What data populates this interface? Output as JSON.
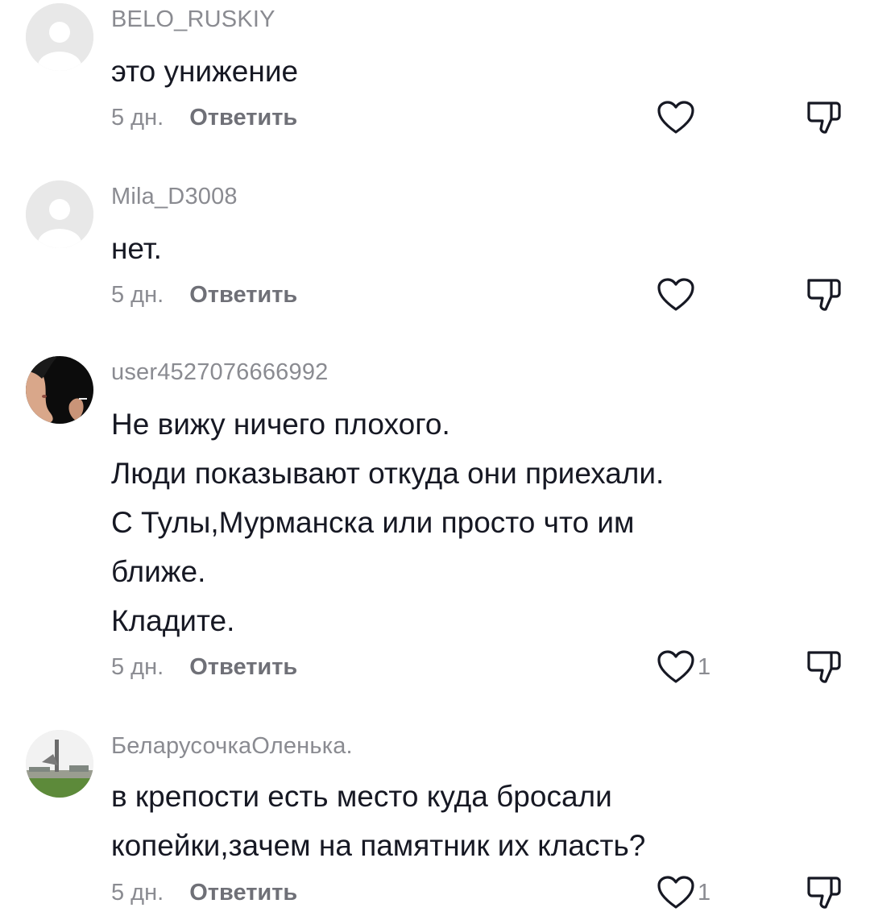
{
  "comments": [
    {
      "username": "BELO_RUSKIY",
      "avatar": "default-avatar",
      "lines": [
        "это унижение"
      ],
      "time": "5 дн.",
      "reply_label": "Ответить",
      "likes": ""
    },
    {
      "username": "Mila_D3008",
      "avatar": "default-avatar",
      "lines": [
        "нет."
      ],
      "time": "5 дн.",
      "reply_label": "Ответить",
      "likes": ""
    },
    {
      "username": "user4527076666992",
      "avatar": "photo-avatar-woman-smoking",
      "lines": [
        "Не вижу ничего плохого.",
        "Люди показывают откуда они приехали.",
        "С Тулы,Мурманска или просто что им",
        "ближе.",
        "Кладите."
      ],
      "time": "5 дн.",
      "reply_label": "Ответить",
      "likes": "1"
    },
    {
      "username": "БеларусочкаОленька.",
      "avatar": "photo-avatar-monument",
      "lines": [
        "в крепости есть место куда бросали",
        "копейки,зачем на памятник их класть?"
      ],
      "time": "5 дн.",
      "reply_label": "Ответить",
      "likes": "1"
    }
  ],
  "icons": {
    "like": "heart-outline-icon",
    "dislike": "thumbs-down-icon"
  },
  "colors": {
    "text": "#161823",
    "secondary": "#8a8b91",
    "reply": "#6f7077",
    "icon": "#161823"
  }
}
